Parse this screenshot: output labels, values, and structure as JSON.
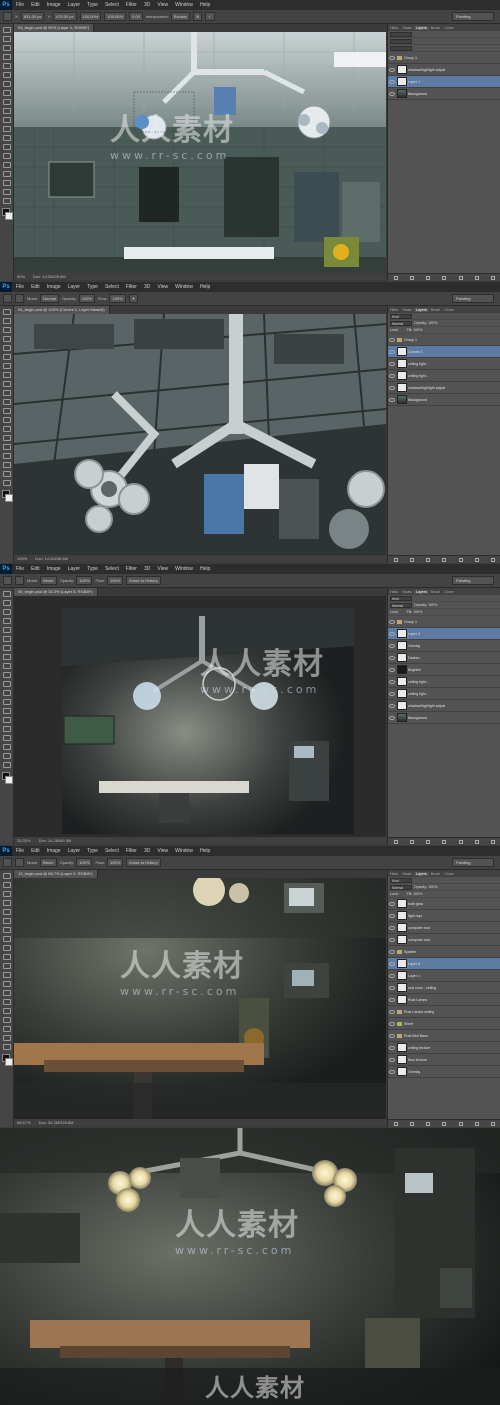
{
  "menu": [
    "File",
    "Edit",
    "Image",
    "Layer",
    "Type",
    "Select",
    "Filter",
    "3D",
    "View",
    "Window",
    "Help"
  ],
  "ps_logo": "Ps",
  "workspace": "Painting",
  "window1": {
    "tab": "03_begin.psd @ 50% (Layer 1, RGB/8*)",
    "options": {
      "x_label": "X:",
      "x": "631.00 px",
      "y_label": "Y:",
      "y": "475.00 px",
      "w": "100.00%",
      "h": "100.00%",
      "angle": "0.00",
      "interp_label": "Interpolation:",
      "interp": "Bicubic"
    },
    "status_zoom": "50%",
    "status_doc": "Doc: 14.2M/25.6M",
    "layers_tabs": [
      "Histo",
      "Swatc",
      "Layers",
      "Brush",
      "Clone"
    ],
    "layers": [
      {
        "name": "Group 1",
        "type": "group"
      },
      {
        "name": "shadow/highlight adjust",
        "type": "layer"
      },
      {
        "name": "Layer 1",
        "type": "layer",
        "active": true
      },
      {
        "name": "Background",
        "type": "image"
      }
    ]
  },
  "window2": {
    "tab": "04_begin.psd @ 100% (Curves 1, Layer Mask/8)",
    "options": {
      "mode_label": "Mode:",
      "mode": "Normal",
      "opacity_label": "Opacity:",
      "opacity": "100%",
      "flow_label": "Flow:",
      "flow": "100%"
    },
    "status_zoom": "100%",
    "status_doc": "Doc: 14.2M/36.6M",
    "layers_tabs": [
      "Histo",
      "Swatc",
      "Layers",
      "Brush",
      "Clone"
    ],
    "kind_label": "Kind",
    "blend": "Normal",
    "opacity_label": "Opacity:",
    "opacity": "100%",
    "lock_label": "Lock:",
    "fill_label": "Fill:",
    "fill": "100%",
    "layers": [
      {
        "name": "Group 1",
        "type": "group"
      },
      {
        "name": "Curves 1",
        "type": "adjust",
        "active": true
      },
      {
        "name": "ceiling light...",
        "type": "mask"
      },
      {
        "name": "ceiling light...",
        "type": "mask"
      },
      {
        "name": "shadow/highlight adjust",
        "type": "layer"
      },
      {
        "name": "Background",
        "type": "image"
      }
    ]
  },
  "window3": {
    "tab": "05_begin.psd @ 33.3% (Layer 5, RGB/8*)",
    "options": {
      "mode_label": "Mode:",
      "mode": "Brush",
      "opacity_label": "Opacity:",
      "opacity": "100%",
      "flow_label": "Flow:",
      "flow": "100%",
      "history": "Erase to History"
    },
    "status_zoom": "33.33%",
    "status_doc": "Doc: 14.2M/69.3M",
    "layers_tabs": [
      "Histo",
      "Swatc",
      "Layers",
      "Brush",
      "Clone"
    ],
    "kind_label": "Kind",
    "blend": "Normal",
    "opacity_label": "Opacity:",
    "opacity": "100%",
    "lock_label": "Lock:",
    "fill_label": "Fill:",
    "fill": "100%",
    "layers": [
      {
        "name": "Group 1",
        "type": "group"
      },
      {
        "name": "Layer 2",
        "type": "layer",
        "active": true
      },
      {
        "name": "Overlay",
        "type": "layer"
      },
      {
        "name": "Darken",
        "type": "mask"
      },
      {
        "name": "Brighten",
        "type": "dark"
      },
      {
        "name": "ceiling light...",
        "type": "mask"
      },
      {
        "name": "ceiling light...",
        "type": "mask"
      },
      {
        "name": "shadow/highlight adjust",
        "type": "layer"
      },
      {
        "name": "Background",
        "type": "image"
      }
    ]
  },
  "window4": {
    "tab": "13_begin.psd @ 66.7% (Layer 5, RGB/8*)",
    "options": {
      "mode_label": "Mode:",
      "mode": "Brush",
      "opacity_label": "Opacity:",
      "opacity": "100%",
      "flow_label": "Flow:",
      "flow": "100%",
      "history": "Erase to History"
    },
    "status_zoom": "66.67%",
    "status_doc": "Doc: 34.3M/326.6M",
    "layers_tabs": [
      "Histo",
      "Swatc",
      "Layers",
      "Brush",
      "Clone"
    ],
    "kind_label": "Kind",
    "blend": "Normal",
    "opacity_label": "Opacity:",
    "opacity": "100%",
    "lock_label": "Lock:",
    "fill_label": "Fill:",
    "fill": "100%",
    "layers": [
      {
        "name": "bulb glow",
        "type": "layer"
      },
      {
        "name": "light rays",
        "type": "layer"
      },
      {
        "name": "computer rust",
        "type": "mask"
      },
      {
        "name": "computer rust",
        "type": "mask"
      },
      {
        "name": "Splatter",
        "type": "group"
      },
      {
        "name": "Layer 5",
        "type": "layer",
        "active": true
      },
      {
        "name": "Layer 1",
        "type": "layer"
      },
      {
        "name": "rust color - ceiling",
        "type": "layer"
      },
      {
        "name": "Rust Lamps",
        "type": "mask"
      },
      {
        "name": "Rust Lamps ceiling",
        "type": "group"
      },
      {
        "name": "Sheet",
        "type": "group"
      },
      {
        "name": "Rust Bed Base",
        "type": "group"
      },
      {
        "name": "ceiling texture",
        "type": "mask"
      },
      {
        "name": "floor texture",
        "type": "mask"
      },
      {
        "name": "Overlay",
        "type": "layer"
      }
    ]
  },
  "watermark": {
    "cn": "人人素材",
    "url": "www.rr-sc.com"
  }
}
